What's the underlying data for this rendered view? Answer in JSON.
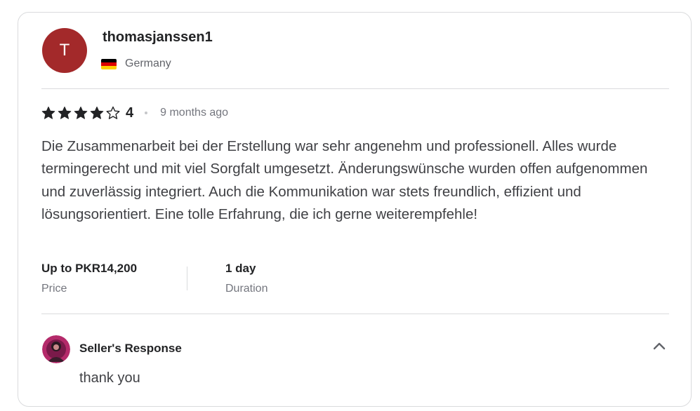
{
  "reviewer": {
    "initial": "T",
    "username": "thomasjanssen1",
    "country": "Germany",
    "flag_colors": [
      "#000000",
      "#dd0000",
      "#ffce00"
    ],
    "avatar_color": "#a3292a"
  },
  "rating": {
    "value": "4",
    "stars_filled": 4,
    "stars_total": 5,
    "time_ago": "9 months ago"
  },
  "review": {
    "text": "Die Zusammenarbeit bei der Erstellung war sehr angenehm und professionell. Alles wurde termingerecht und mit viel Sorgfalt umgesetzt. Änderungswünsche wurden offen aufgenommen und zuverlässig integriert. Auch die Kommunikation war stets freundlich, effizient und lösungsorientiert. Eine tolle Erfahrung, die ich gerne weiterempfehle!"
  },
  "meta": {
    "price_value": "Up to PKR14,200",
    "price_label": "Price",
    "duration_value": "1 day",
    "duration_label": "Duration"
  },
  "seller_response": {
    "title": "Seller's Response",
    "text": "thank you",
    "collapse_icon": "chevron-up-icon"
  }
}
